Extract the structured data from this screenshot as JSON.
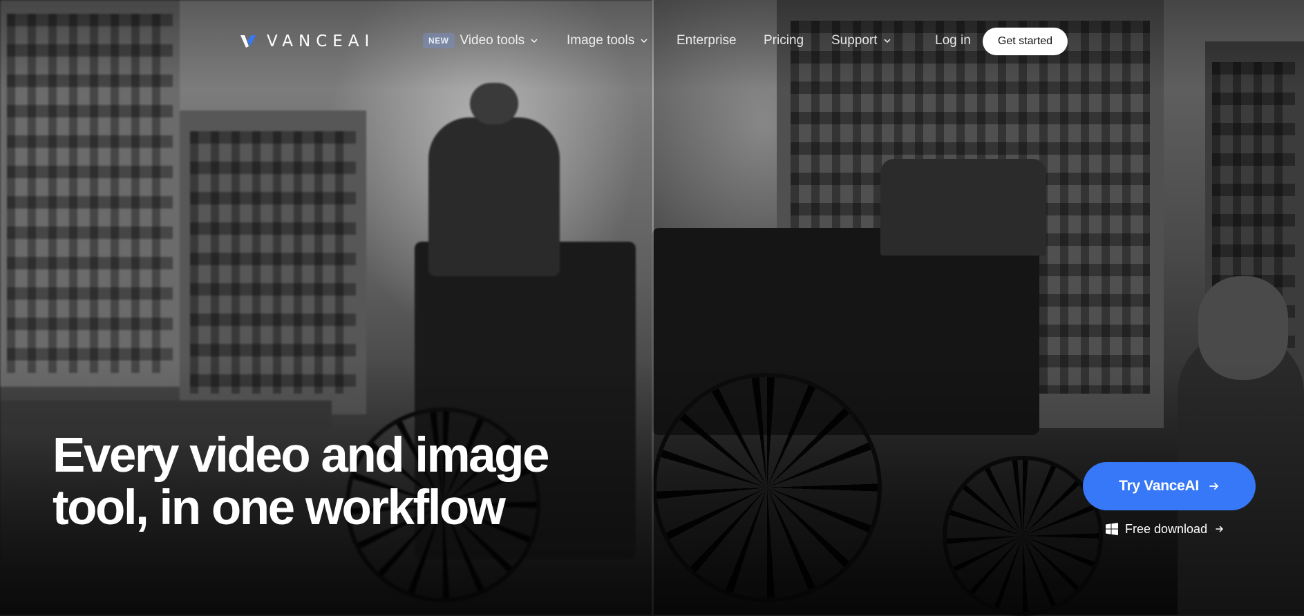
{
  "brand": {
    "name": "VANCEAI"
  },
  "nav": {
    "video_badge": "NEW",
    "video_tools": "Video tools",
    "image_tools": "Image tools",
    "enterprise": "Enterprise",
    "pricing": "Pricing",
    "support": "Support",
    "login": "Log in",
    "get_started": "Get started"
  },
  "hero": {
    "headline_line1": "Every video and image",
    "headline_line2": "tool, in one workflow",
    "try_button": "Try VanceAI",
    "free_download": "Free download"
  },
  "colors": {
    "accent": "#3678f7",
    "badge_bg": "#5a6a94",
    "button_light": "#ffffff"
  },
  "icons": {
    "dropdown": "chevron-down-icon",
    "cta_arrow": "arrow-right-icon",
    "os": "windows-icon"
  }
}
